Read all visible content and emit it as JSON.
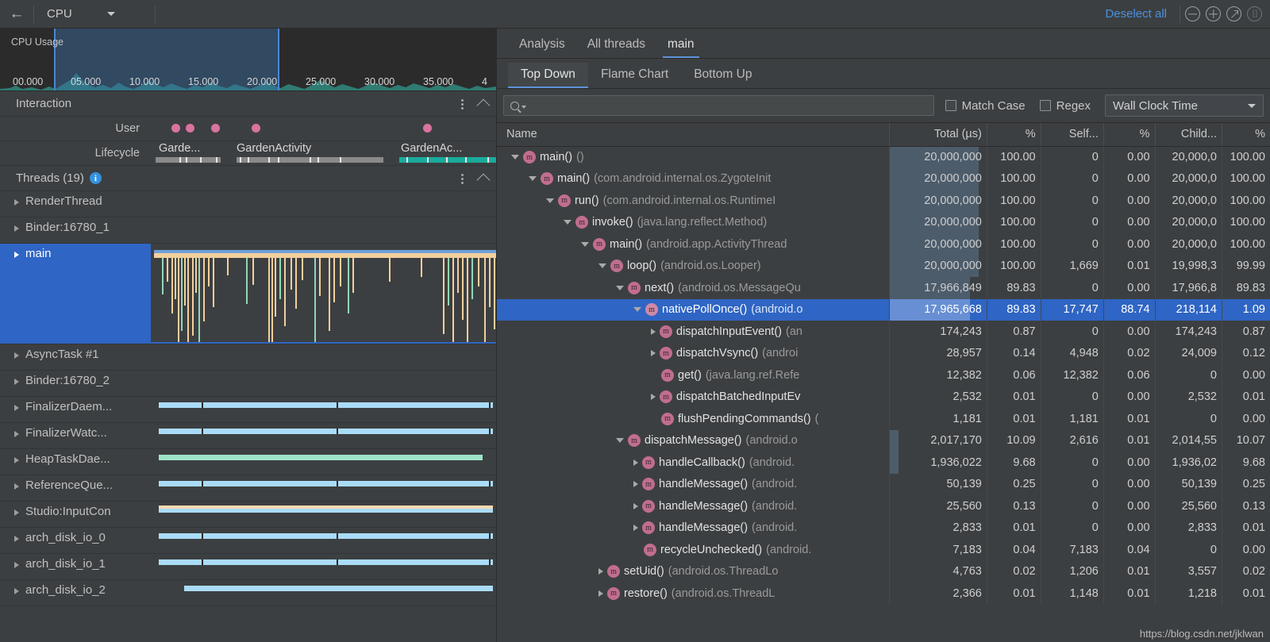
{
  "toolbar": {
    "back_icon": "arrow-left-icon",
    "profiler_name": "CPU",
    "deselect_label": "Deselect all",
    "icons": [
      "zoom-out-icon",
      "zoom-in-icon",
      "reset-zoom-icon",
      "fit-to-screen-icon"
    ]
  },
  "cpu_timeline": {
    "label": "CPU Usage",
    "axis_ticks": [
      "00.000",
      "05.000",
      "10.000",
      "15.000",
      "20.000",
      "25.000",
      "30.000",
      "35.000",
      "4"
    ],
    "selection_start": "05.000",
    "selection_end": "20.000",
    "accent": "#4a86d8"
  },
  "interaction": {
    "title": "Interaction",
    "tracks": [
      {
        "label": "User",
        "type": "events"
      },
      {
        "label": "Lifecycle",
        "type": "lifecycle",
        "segments": [
          "Garde...",
          "GardenActivity",
          "GardenAc..."
        ]
      }
    ]
  },
  "threads": {
    "title": "Threads (19)",
    "info_glyph": "i",
    "items": [
      {
        "name": "RenderThread",
        "selected": false,
        "track": "empty"
      },
      {
        "name": "Binder:16780_1",
        "selected": false,
        "track": "empty"
      },
      {
        "name": "main",
        "selected": true,
        "track": "flame"
      },
      {
        "name": "AsyncTask #1",
        "selected": false,
        "track": "empty"
      },
      {
        "name": "Binder:16780_2",
        "selected": false,
        "track": "empty"
      },
      {
        "name": "FinalizerDaem...",
        "selected": false,
        "track": "blue"
      },
      {
        "name": "FinalizerWatc...",
        "selected": false,
        "track": "blue"
      },
      {
        "name": "HeapTaskDae...",
        "selected": false,
        "track": "mint"
      },
      {
        "name": "ReferenceQue...",
        "selected": false,
        "track": "blue"
      },
      {
        "name": "Studio:InputCon",
        "selected": false,
        "track": "blue-peach"
      },
      {
        "name": "arch_disk_io_0",
        "selected": false,
        "track": "blue"
      },
      {
        "name": "arch_disk_io_1",
        "selected": false,
        "track": "blue"
      },
      {
        "name": "arch_disk_io_2",
        "selected": false,
        "track": "blue-offset"
      }
    ]
  },
  "analysis": {
    "tabs": [
      {
        "label": "Analysis",
        "active": false
      },
      {
        "label": "All threads",
        "active": false
      },
      {
        "label": "main",
        "active": true
      }
    ],
    "subtabs": [
      {
        "label": "Top Down",
        "active": true
      },
      {
        "label": "Flame Chart",
        "active": false
      },
      {
        "label": "Bottom Up",
        "active": false
      }
    ],
    "filter": {
      "search_value": "",
      "search_placeholder": "",
      "search_icon": "search-icon",
      "match_case_label": "Match Case",
      "match_case_checked": false,
      "regex_label": "Regex",
      "regex_checked": false,
      "clock_selected": "Wall Clock Time"
    }
  },
  "table": {
    "headers": [
      "Name",
      "Total (µs)",
      "%",
      "Self...",
      "%",
      "Child...",
      "%"
    ],
    "watermark": "https://blog.csdn.net/jklwan",
    "rows": [
      {
        "depth": 0,
        "twisty": "open",
        "method": "main()",
        "pkg": "()",
        "total": "20,000,000",
        "pct": "100.00",
        "self": "0",
        "selfpct": "0.00",
        "child": "20,000,0",
        "childpct": "100.00",
        "tint": 100,
        "selected": false
      },
      {
        "depth": 1,
        "twisty": "open",
        "method": "main()",
        "pkg": "(com.android.internal.os.ZygoteInit",
        "total": "20,000,000",
        "pct": "100.00",
        "self": "0",
        "selfpct": "0.00",
        "child": "20,000,0",
        "childpct": "100.00",
        "tint": 100,
        "selected": false
      },
      {
        "depth": 2,
        "twisty": "open",
        "method": "run()",
        "pkg": "(com.android.internal.os.RuntimeI",
        "total": "20,000,000",
        "pct": "100.00",
        "self": "0",
        "selfpct": "0.00",
        "child": "20,000,0",
        "childpct": "100.00",
        "tint": 100,
        "selected": false
      },
      {
        "depth": 3,
        "twisty": "open",
        "method": "invoke()",
        "pkg": "(java.lang.reflect.Method)",
        "total": "20,000,000",
        "pct": "100.00",
        "self": "0",
        "selfpct": "0.00",
        "child": "20,000,0",
        "childpct": "100.00",
        "tint": 100,
        "selected": false
      },
      {
        "depth": 4,
        "twisty": "open",
        "method": "main()",
        "pkg": "(android.app.ActivityThread",
        "total": "20,000,000",
        "pct": "100.00",
        "self": "0",
        "selfpct": "0.00",
        "child": "20,000,0",
        "childpct": "100.00",
        "tint": 100,
        "selected": false
      },
      {
        "depth": 5,
        "twisty": "open",
        "method": "loop()",
        "pkg": "(android.os.Looper)",
        "total": "20,000,000",
        "pct": "100.00",
        "self": "1,669",
        "selfpct": "0.01",
        "child": "19,998,3",
        "childpct": "99.99",
        "tint": 100,
        "selected": false
      },
      {
        "depth": 6,
        "twisty": "open",
        "method": "next()",
        "pkg": "(android.os.MessageQu",
        "total": "17,966,849",
        "pct": "89.83",
        "self": "0",
        "selfpct": "0.00",
        "child": "17,966,8",
        "childpct": "89.83",
        "tint": 90,
        "selected": false
      },
      {
        "depth": 7,
        "twisty": "open",
        "method": "nativePollOnce()",
        "pkg": "(android.o",
        "total": "17,965,668",
        "pct": "89.83",
        "self": "17,747",
        "selfpct": "88.74",
        "child": "218,114",
        "childpct": "1.09",
        "tint": 90,
        "selected": true
      },
      {
        "depth": 8,
        "twisty": "closed",
        "method": "dispatchInputEvent()",
        "pkg": "(an",
        "total": "174,243",
        "pct": "0.87",
        "self": "0",
        "selfpct": "0.00",
        "child": "174,243",
        "childpct": "0.87",
        "tint": 0,
        "selected": false
      },
      {
        "depth": 8,
        "twisty": "closed",
        "method": "dispatchVsync()",
        "pkg": "(androi",
        "total": "28,957",
        "pct": "0.14",
        "self": "4,948",
        "selfpct": "0.02",
        "child": "24,009",
        "childpct": "0.12",
        "tint": 0,
        "selected": false
      },
      {
        "depth": 8,
        "twisty": "none",
        "method": "get()",
        "pkg": "(java.lang.ref.Refe",
        "total": "12,382",
        "pct": "0.06",
        "self": "12,382",
        "selfpct": "0.06",
        "child": "0",
        "childpct": "0.00",
        "tint": 0,
        "selected": false
      },
      {
        "depth": 8,
        "twisty": "closed",
        "method": "dispatchBatchedInputEv",
        "pkg": "",
        "total": "2,532",
        "pct": "0.01",
        "self": "0",
        "selfpct": "0.00",
        "child": "2,532",
        "childpct": "0.01",
        "tint": 0,
        "selected": false
      },
      {
        "depth": 8,
        "twisty": "none",
        "method": "flushPendingCommands()",
        "pkg": "(",
        "total": "1,181",
        "pct": "0.01",
        "self": "1,181",
        "selfpct": "0.01",
        "child": "0",
        "childpct": "0.00",
        "tint": 0,
        "selected": false
      },
      {
        "depth": 6,
        "twisty": "open",
        "method": "dispatchMessage()",
        "pkg": "(android.o",
        "total": "2,017,170",
        "pct": "10.09",
        "self": "2,616",
        "selfpct": "0.01",
        "child": "2,014,55",
        "childpct": "10.07",
        "tint": 10,
        "selected": false
      },
      {
        "depth": 7,
        "twisty": "closed",
        "method": "handleCallback()",
        "pkg": "(android.",
        "total": "1,936,022",
        "pct": "9.68",
        "self": "0",
        "selfpct": "0.00",
        "child": "1,936,02",
        "childpct": "9.68",
        "tint": 10,
        "selected": false
      },
      {
        "depth": 7,
        "twisty": "closed",
        "method": "handleMessage()",
        "pkg": "(android.",
        "total": "50,139",
        "pct": "0.25",
        "self": "0",
        "selfpct": "0.00",
        "child": "50,139",
        "childpct": "0.25",
        "tint": 0,
        "selected": false
      },
      {
        "depth": 7,
        "twisty": "closed",
        "method": "handleMessage()",
        "pkg": "(android.",
        "total": "25,560",
        "pct": "0.13",
        "self": "0",
        "selfpct": "0.00",
        "child": "25,560",
        "childpct": "0.13",
        "tint": 0,
        "selected": false
      },
      {
        "depth": 7,
        "twisty": "closed",
        "method": "handleMessage()",
        "pkg": "(android.",
        "total": "2,833",
        "pct": "0.01",
        "self": "0",
        "selfpct": "0.00",
        "child": "2,833",
        "childpct": "0.01",
        "tint": 0,
        "selected": false
      },
      {
        "depth": 7,
        "twisty": "none",
        "method": "recycleUnchecked()",
        "pkg": "(android.",
        "total": "7,183",
        "pct": "0.04",
        "self": "7,183",
        "selfpct": "0.04",
        "child": "0",
        "childpct": "0.00",
        "tint": 0,
        "selected": false
      },
      {
        "depth": 5,
        "twisty": "closed",
        "method": "setUid()",
        "pkg": "(android.os.ThreadLo",
        "total": "4,763",
        "pct": "0.02",
        "self": "1,206",
        "selfpct": "0.01",
        "child": "3,557",
        "childpct": "0.02",
        "tint": 0,
        "selected": false
      },
      {
        "depth": 5,
        "twisty": "closed",
        "method": "restore()",
        "pkg": "(android.os.ThreadL",
        "total": "2,366",
        "pct": "0.01",
        "self": "1,148",
        "selfpct": "0.01",
        "child": "1,218",
        "childpct": "0.01",
        "tint": 0,
        "selected": false
      }
    ]
  }
}
